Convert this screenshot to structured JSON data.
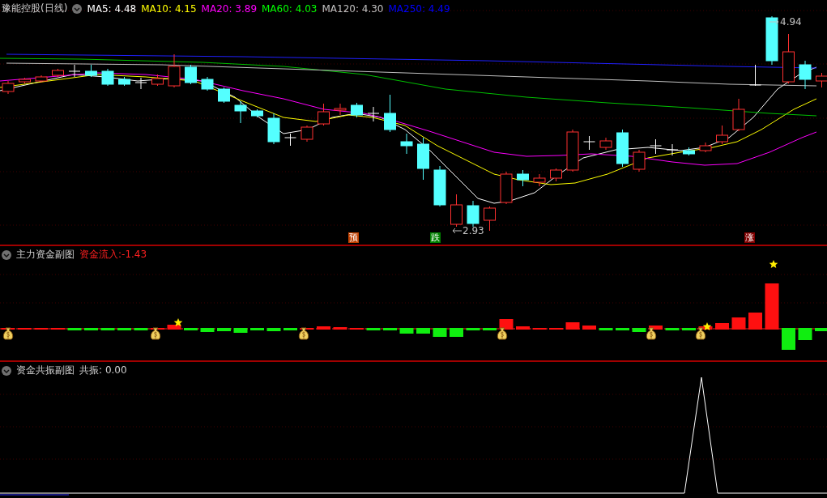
{
  "main_panel": {
    "title": "豫能控股(日线)",
    "indicators": [
      {
        "label": "MA5:",
        "value": "4.48",
        "color": "#ffffff"
      },
      {
        "label": "MA10:",
        "value": "4.15",
        "color": "#ffff00"
      },
      {
        "label": "MA20:",
        "value": "3.89",
        "color": "#ff00ff"
      },
      {
        "label": "MA60:",
        "value": "4.03",
        "color": "#00ff00"
      },
      {
        "label": "MA120:",
        "value": "4.30",
        "color": "#c0c0c0"
      },
      {
        "label": "MA250:",
        "value": "4.49",
        "color": "#0000ff"
      }
    ],
    "price_labels": [
      {
        "text": "4.94"
      },
      {
        "text": "2.93"
      }
    ],
    "signals": [
      {
        "text": "预",
        "color": "#c04000"
      },
      {
        "text": "跌",
        "color": "#008000"
      },
      {
        "text": "涨",
        "color": "#800000"
      }
    ]
  },
  "flow_panel": {
    "title": "主力资金副图",
    "reading_label": "资金流入:",
    "reading_value": "-1.43"
  },
  "resonance_panel": {
    "title": "资金共振副图",
    "reading_label": "共振:",
    "reading_value": "0.00"
  }
}
